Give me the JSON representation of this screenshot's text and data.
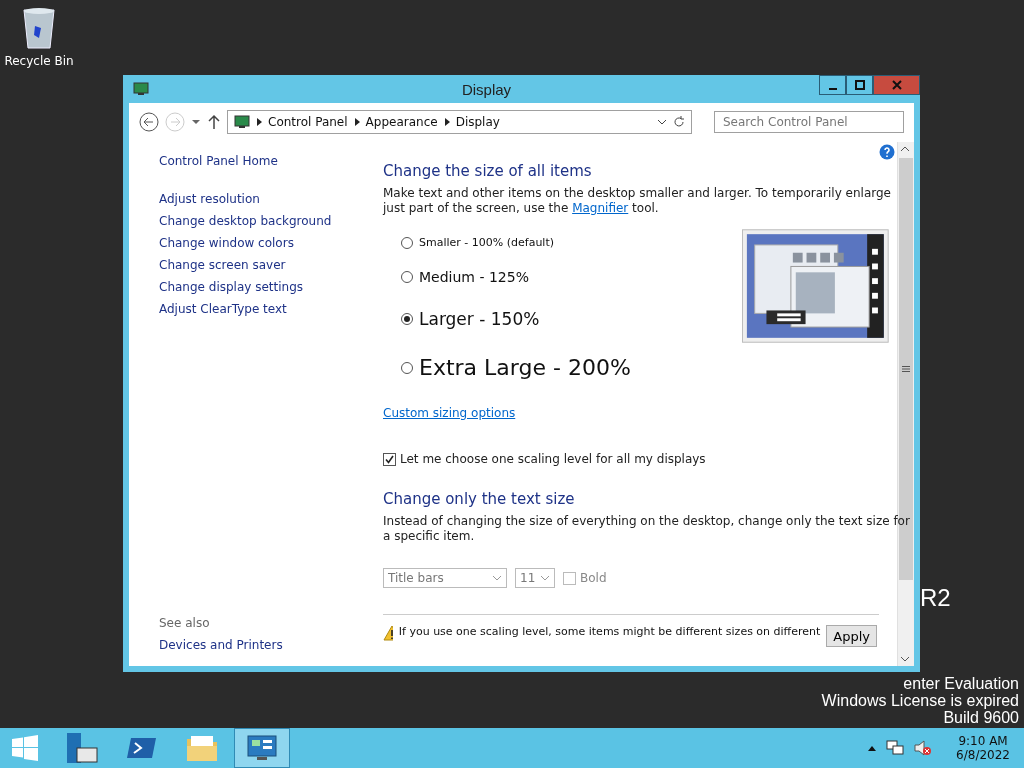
{
  "desktop": {
    "icons": [
      {
        "label": "Recycle Bin"
      }
    ],
    "edition_fragment": "R2",
    "branding": [
      "enter Evaluation",
      "Windows License is expired",
      "Build 9600"
    ]
  },
  "window": {
    "title": "Display",
    "address": {
      "path": [
        "Control Panel",
        "Appearance",
        "Display"
      ],
      "search_placeholder": "Search Control Panel"
    },
    "sidebar": {
      "home": "Control Panel Home",
      "links": [
        "Adjust resolution",
        "Change desktop background",
        "Change window colors",
        "Change screen saver",
        "Change display settings",
        "Adjust ClearType text"
      ],
      "see_also_heading": "See also",
      "see_also": [
        "Devices and Printers"
      ]
    },
    "main": {
      "heading": "Change the size of all items",
      "description": {
        "before": "Make text and other items on the desktop smaller and larger. To temporarily enlarge just part of the screen, use the",
        "link": "Magnifier",
        "after": "tool."
      },
      "options": [
        {
          "label": "Smaller - 100% (default)",
          "selected": false
        },
        {
          "label": "Medium - 125%",
          "selected": false
        },
        {
          "label": "Larger - 150%",
          "selected": true
        },
        {
          "label": "Extra Large - 200%",
          "selected": false
        }
      ],
      "custom_link": "Custom sizing options",
      "one_level": {
        "label": "Let me choose one scaling level for all my displays",
        "checked": true
      },
      "text_heading": "Change only the text size",
      "text_description": "Instead of changing the size of everything on the desktop, change only the text size for a specific item.",
      "item_select": "Title bars",
      "size_select": "11",
      "bold": {
        "label": "Bold",
        "checked": false
      },
      "warning": "If you use one scaling level, some items might be different sizes on different",
      "apply": "Apply"
    }
  },
  "taskbar": {
    "apps": [
      {
        "kind": "server",
        "selected": false
      },
      {
        "kind": "powershell",
        "selected": false
      },
      {
        "kind": "explorer",
        "selected": false
      },
      {
        "kind": "control",
        "selected": true
      }
    ],
    "time": "9:10 AM",
    "date": "6/8/2022"
  }
}
